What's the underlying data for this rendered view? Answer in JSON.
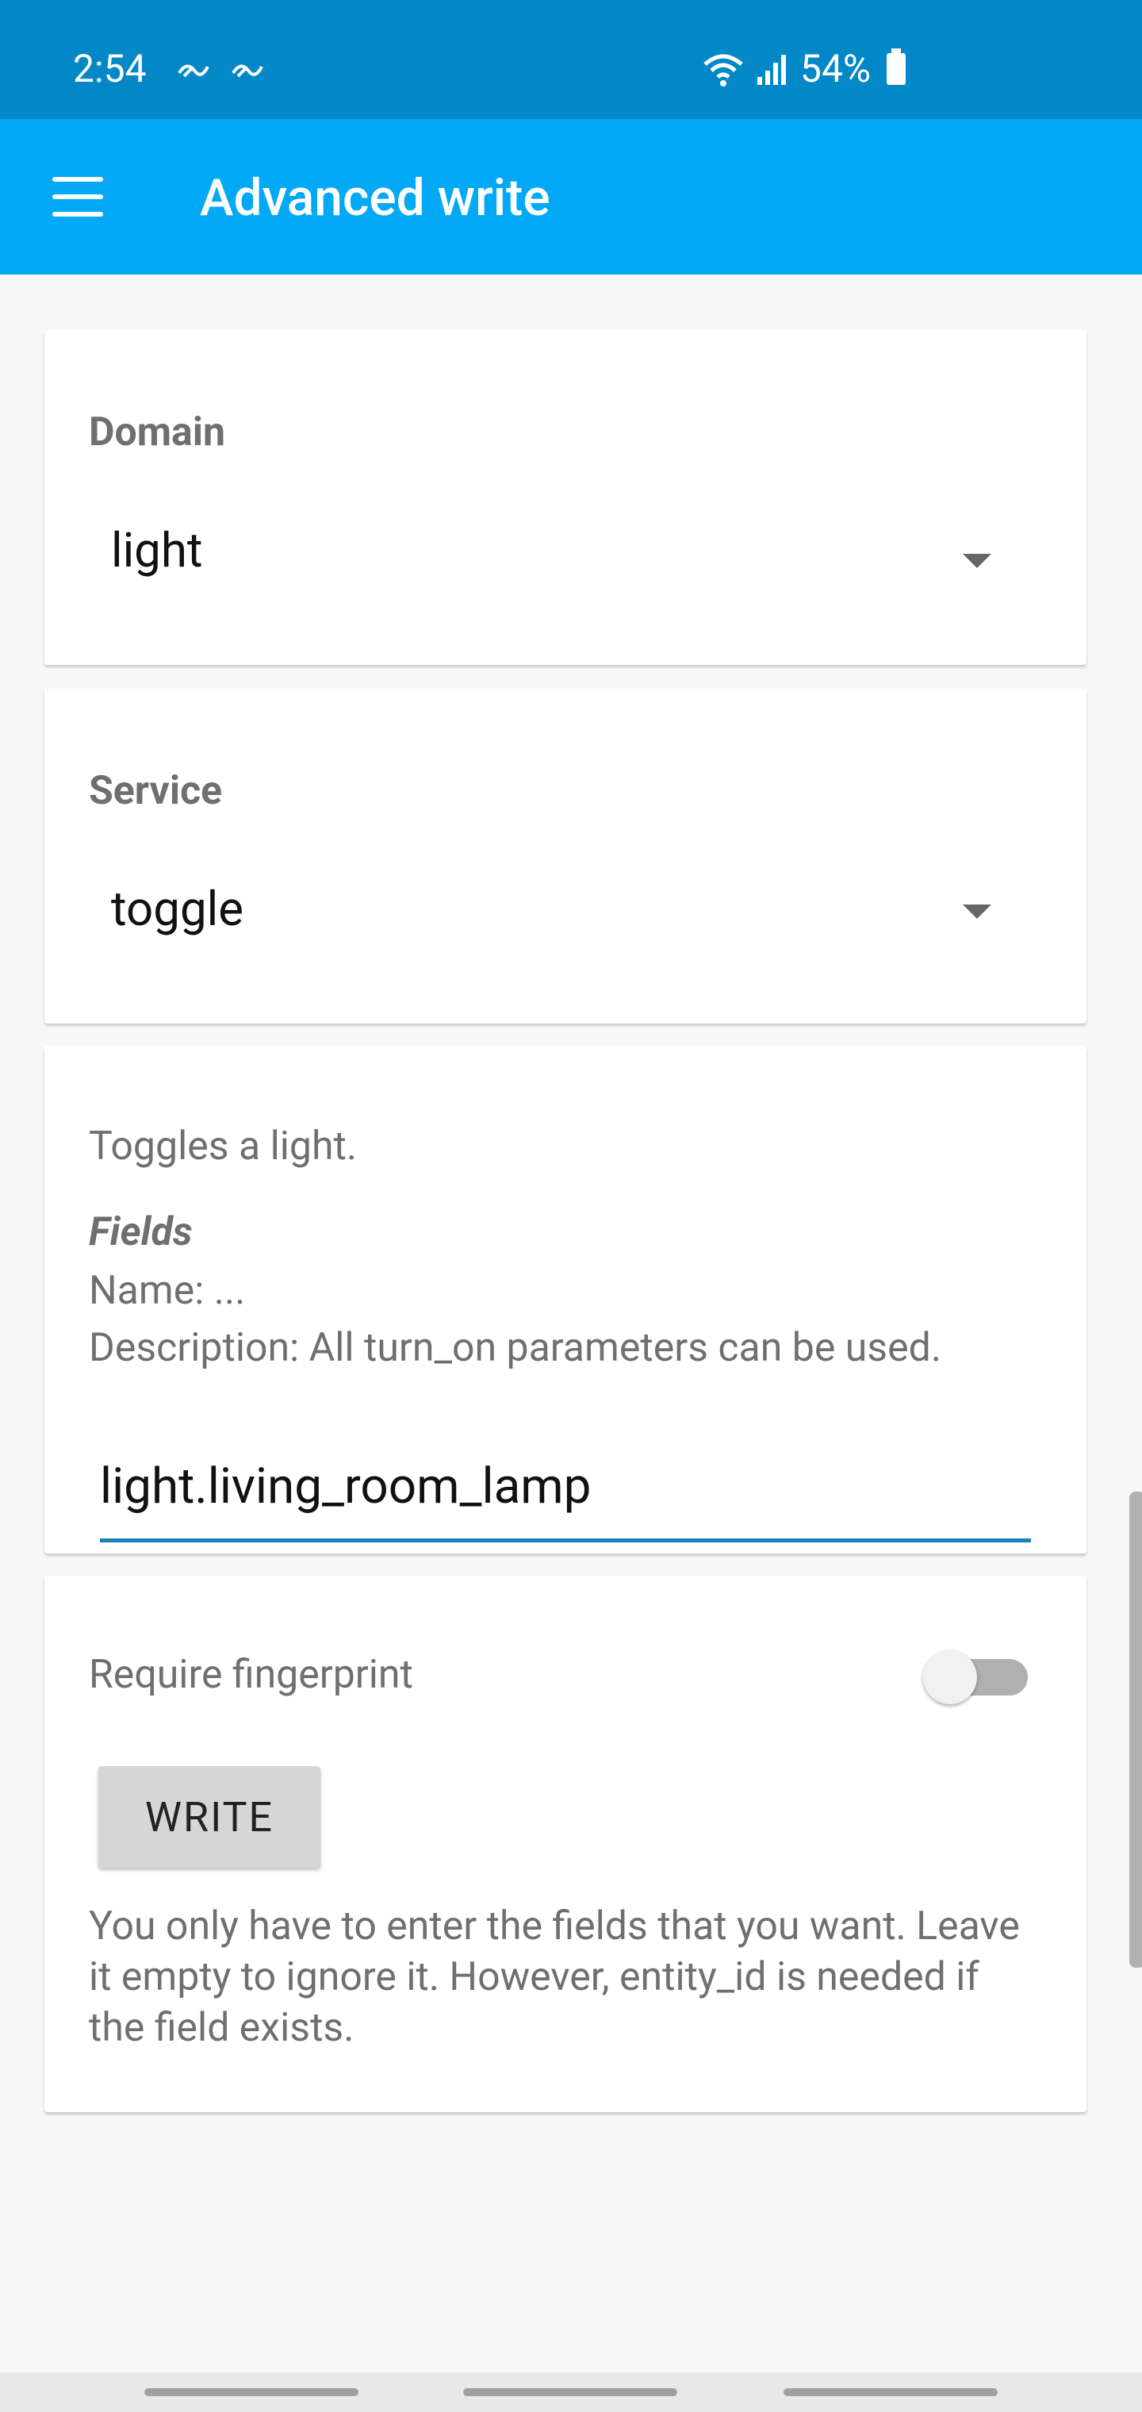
{
  "status_bar": {
    "time": "2:54",
    "battery": "54%"
  },
  "app_bar": {
    "title": "Advanced write"
  },
  "domain": {
    "label": "Domain",
    "value": "light"
  },
  "service": {
    "label": "Service",
    "value": "toggle"
  },
  "service_info": {
    "description": "Toggles a light.",
    "fields_title": "Fields",
    "field_name": "Name: ...",
    "field_description": "Description: All turn_on parameters can be used.",
    "entity_value": "light.living_room_lamp"
  },
  "options": {
    "require_fingerprint_label": "Require fingerprint",
    "require_fingerprint_on": false,
    "write_button": "WRITE",
    "help_text": "You only have to enter the fields that you want. Leave it empty to ignore it. However, entity_id is needed if the field exists."
  }
}
